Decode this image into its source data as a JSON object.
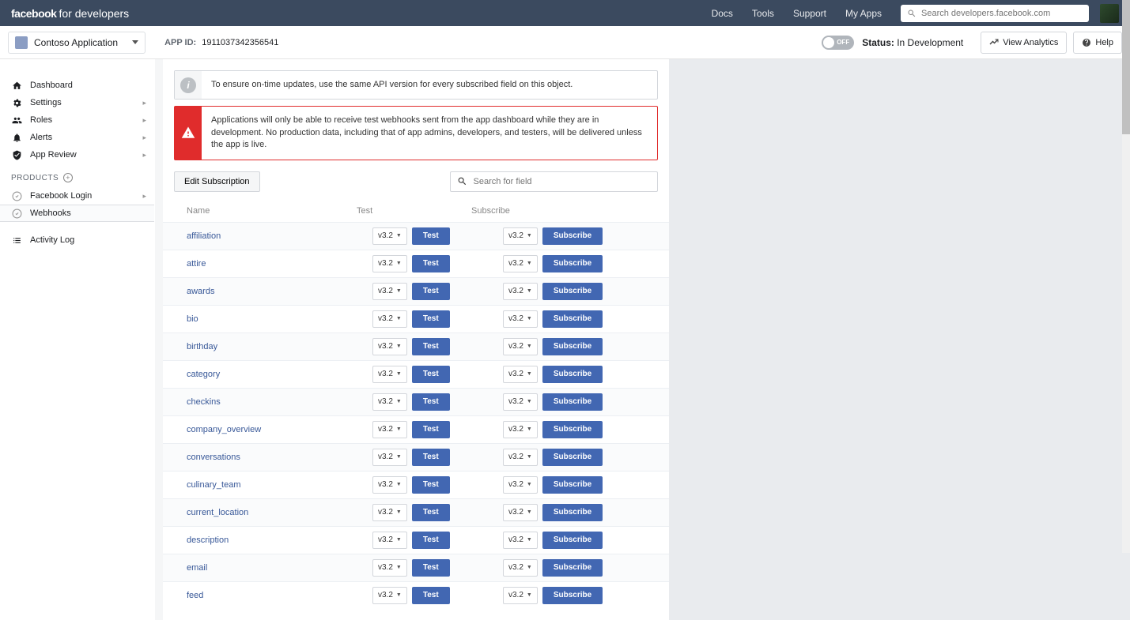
{
  "topnav": {
    "brand_bold": "facebook",
    "brand_light": "for developers",
    "links": [
      "Docs",
      "Tools",
      "Support",
      "My Apps"
    ],
    "search_placeholder": "Search developers.facebook.com"
  },
  "subheader": {
    "app_name": "Contoso Application",
    "appid_label": "APP ID:",
    "appid_value": "1911037342356541",
    "toggle_label": "OFF",
    "status_label": "Status:",
    "status_value": "In Development",
    "view_analytics": "View Analytics",
    "help": "Help"
  },
  "sidebar": {
    "items": [
      {
        "label": "Dashboard",
        "icon": "home",
        "chev": false
      },
      {
        "label": "Settings",
        "icon": "gear",
        "chev": true
      },
      {
        "label": "Roles",
        "icon": "roles",
        "chev": true
      },
      {
        "label": "Alerts",
        "icon": "bell",
        "chev": true
      },
      {
        "label": "App Review",
        "icon": "shield",
        "chev": true
      }
    ],
    "products_label": "PRODUCTS",
    "products": [
      {
        "label": "Facebook Login",
        "chev": true,
        "active": false
      },
      {
        "label": "Webhooks",
        "chev": false,
        "active": true
      }
    ],
    "activity_log": "Activity Log"
  },
  "alerts": {
    "info": "To ensure on-time updates, use the same API version for every subscribed field on this object.",
    "warn": "Applications will only be able to receive test webhooks sent from the app dashboard while they are in development. No production data, including that of app admins, developers, and testers, will be delivered unless the app is live."
  },
  "toolbar": {
    "edit_subscription": "Edit Subscription",
    "search_placeholder": "Search for field"
  },
  "table": {
    "headers": {
      "name": "Name",
      "test": "Test",
      "subscribe": "Subscribe"
    },
    "version": "v3.2",
    "test_btn": "Test",
    "subscribe_btn": "Subscribe",
    "fields": [
      "affiliation",
      "attire",
      "awards",
      "bio",
      "birthday",
      "category",
      "checkins",
      "company_overview",
      "conversations",
      "culinary_team",
      "current_location",
      "description",
      "email",
      "feed"
    ]
  }
}
